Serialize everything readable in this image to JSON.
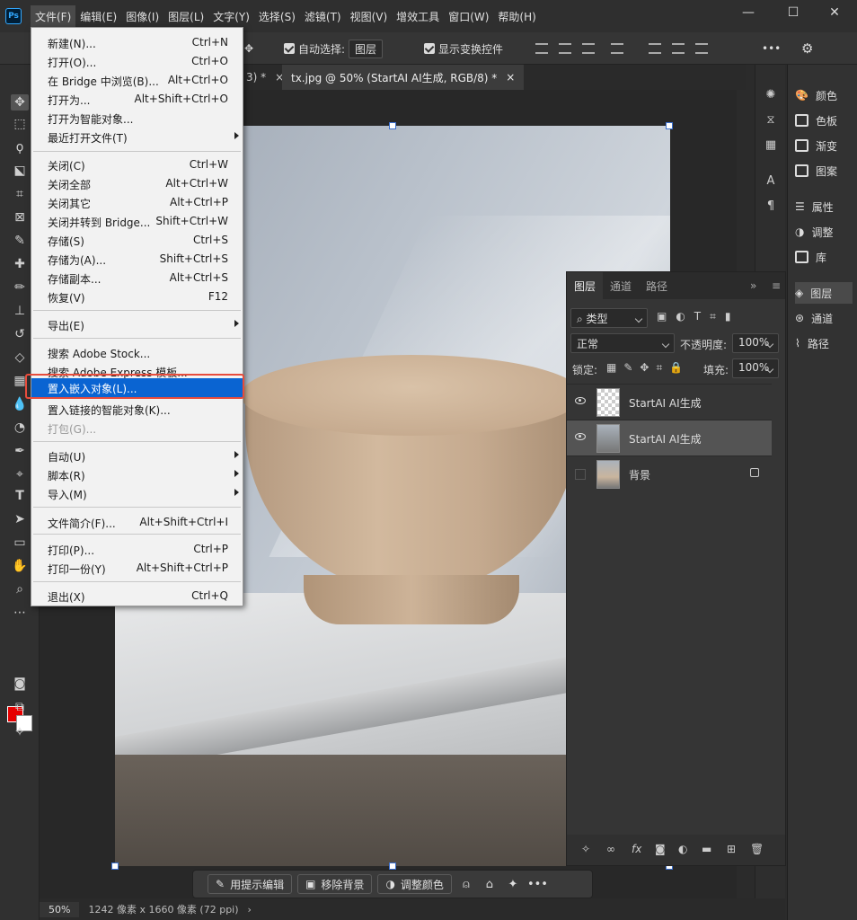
{
  "menubar": {
    "logo": "Ps",
    "items": [
      "文件(F)",
      "编辑(E)",
      "图像(I)",
      "图层(L)",
      "文字(Y)",
      "选择(S)",
      "滤镜(T)",
      "视图(V)",
      "增效工具",
      "窗口(W)",
      "帮助(H)"
    ]
  },
  "window_controls": {
    "minimize": "—",
    "maximize": "☐",
    "close": "✕"
  },
  "options_bar": {
    "auto_select_label": "自动选择:",
    "auto_select_value": "图层",
    "show_transform_label": "显示变换控件",
    "more": "•••"
  },
  "tabs": [
    {
      "label": "3) *",
      "close": "×"
    },
    {
      "label": "tx.jpg @ 50% (StartAI AI生成, RGB/8) *",
      "close": "×"
    }
  ],
  "file_menu": {
    "items": [
      {
        "label": "新建(N)...",
        "shortcut": "Ctrl+N"
      },
      {
        "label": "打开(O)...",
        "shortcut": "Ctrl+O"
      },
      {
        "label": "在 Bridge 中浏览(B)...",
        "shortcut": "Alt+Ctrl+O"
      },
      {
        "label": "打开为...",
        "shortcut": "Alt+Shift+Ctrl+O"
      },
      {
        "label": "打开为智能对象...",
        "shortcut": ""
      },
      {
        "label": "最近打开文件(T)",
        "shortcut": ""
      },
      {
        "label": "关闭(C)",
        "shortcut": "Ctrl+W"
      },
      {
        "label": "关闭全部",
        "shortcut": "Alt+Ctrl+W"
      },
      {
        "label": "关闭其它",
        "shortcut": "Alt+Ctrl+P"
      },
      {
        "label": "关闭并转到 Bridge...",
        "shortcut": "Shift+Ctrl+W"
      },
      {
        "label": "存储(S)",
        "shortcut": "Ctrl+S"
      },
      {
        "label": "存储为(A)...",
        "shortcut": "Shift+Ctrl+S"
      },
      {
        "label": "存储副本...",
        "shortcut": "Alt+Ctrl+S"
      },
      {
        "label": "恢复(V)",
        "shortcut": "F12"
      },
      {
        "label": "导出(E)",
        "shortcut": ""
      },
      {
        "label": "搜索 Adobe Stock...",
        "shortcut": ""
      },
      {
        "label": "搜索 Adobe Express 模板...",
        "shortcut": ""
      },
      {
        "label": "置入嵌入对象(L)...",
        "shortcut": ""
      },
      {
        "label": "置入链接的智能对象(K)...",
        "shortcut": ""
      },
      {
        "label": "打包(G)...",
        "shortcut": ""
      },
      {
        "label": "自动(U)",
        "shortcut": ""
      },
      {
        "label": "脚本(R)",
        "shortcut": ""
      },
      {
        "label": "导入(M)",
        "shortcut": ""
      },
      {
        "label": "文件简介(F)...",
        "shortcut": "Alt+Shift+Ctrl+I"
      },
      {
        "label": "打印(P)...",
        "shortcut": "Ctrl+P"
      },
      {
        "label": "打印一份(Y)",
        "shortcut": "Alt+Shift+Ctrl+P"
      },
      {
        "label": "退出(X)",
        "shortcut": "Ctrl+Q"
      }
    ]
  },
  "right_panel": {
    "items": [
      "颜色",
      "色板",
      "渐变",
      "图案",
      "属性",
      "调整",
      "库",
      "图层",
      "通道",
      "路径"
    ]
  },
  "layers_panel": {
    "tabs": [
      "图层",
      "通道",
      "路径"
    ],
    "filter_label": "类型",
    "blend_mode": "正常",
    "opacity_label": "不透明度:",
    "opacity_value": "100%",
    "lock_label": "锁定:",
    "fill_label": "填充:",
    "fill_value": "100%",
    "layers": [
      {
        "name": "StartAI AI生成"
      },
      {
        "name": "StartAI AI生成"
      },
      {
        "name": "背景"
      }
    ],
    "footer_fx": "fx"
  },
  "contextual_bar": {
    "edit_prompt": "用提示编辑",
    "remove_bg": "移除背景",
    "adjust_color": "调整颜色",
    "more": "•••"
  },
  "status_bar": {
    "zoom": "50%",
    "doc_info": "1242 像素 x 1660 像素 (72 ppi)",
    "arrow": "›"
  },
  "colors": {
    "accent": "#0a64d2",
    "highlight_box": "#e74c3c",
    "foreground": "#e60000",
    "background": "#ffffff"
  }
}
